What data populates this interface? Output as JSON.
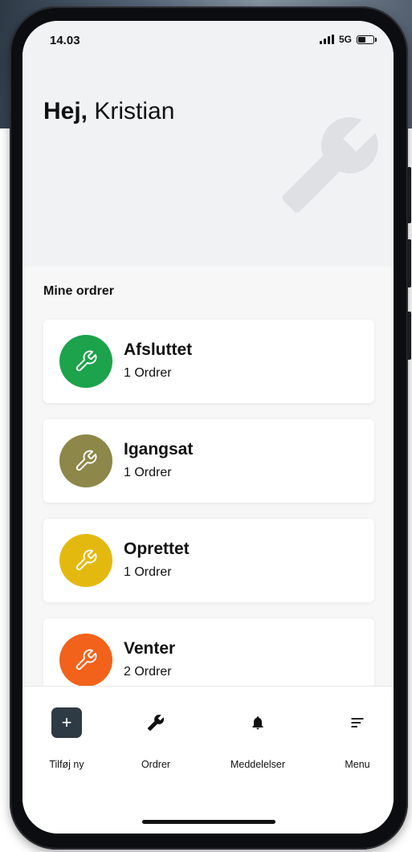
{
  "status_bar": {
    "time": "14.03",
    "network": "5G"
  },
  "header": {
    "greeting_bold": "Hej,",
    "greeting_name": "Kristian",
    "decor_icon": "wrench-icon"
  },
  "orders_section": {
    "title": "Mine ordrer",
    "items": [
      {
        "title": "Afsluttet",
        "count": "1 Ordrer",
        "color": "#1ca34c",
        "icon": "wrench-icon"
      },
      {
        "title": "Igangsat",
        "count": "1 Ordrer",
        "color": "#8d8749",
        "icon": "wrench-icon"
      },
      {
        "title": "Oprettet",
        "count": "1 Ordrer",
        "color": "#e4b90f",
        "icon": "wrench-icon"
      },
      {
        "title": "Venter",
        "count": "2 Ordrer",
        "color": "#f2621b",
        "icon": "wrench-icon"
      }
    ]
  },
  "bottom_nav": {
    "items": [
      {
        "label": "Tilføj ny",
        "icon": "plus-icon"
      },
      {
        "label": "Ordrer",
        "icon": "wrench-icon"
      },
      {
        "label": "Meddelelser",
        "icon": "bell-icon"
      },
      {
        "label": "Menu",
        "icon": "menu-lines-icon"
      }
    ]
  },
  "colors": {
    "header_bg": "#f1f2f4",
    "nav_add_bg": "#2f3b44"
  }
}
